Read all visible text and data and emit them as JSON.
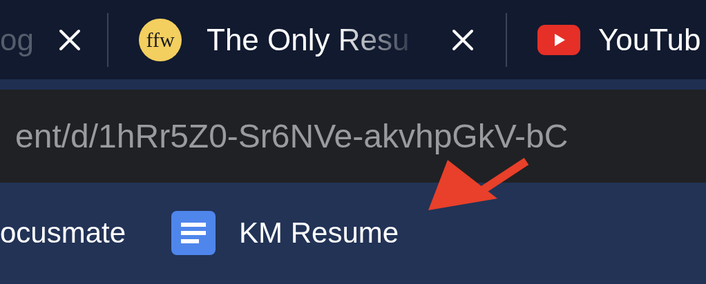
{
  "tabs": [
    {
      "title": "og",
      "selected": false
    },
    {
      "title": "The Only Resu",
      "selected": false
    },
    {
      "title": "YouTub",
      "selected": false
    }
  ],
  "address_bar": {
    "url": "ent/d/1hRr5Z0-Sr6NVe-akvhpGkV-bC"
  },
  "bookmarks": [
    {
      "title": "ocusmate"
    },
    {
      "title": "KM Resume"
    }
  ],
  "ffw_logo_text": "ffw"
}
